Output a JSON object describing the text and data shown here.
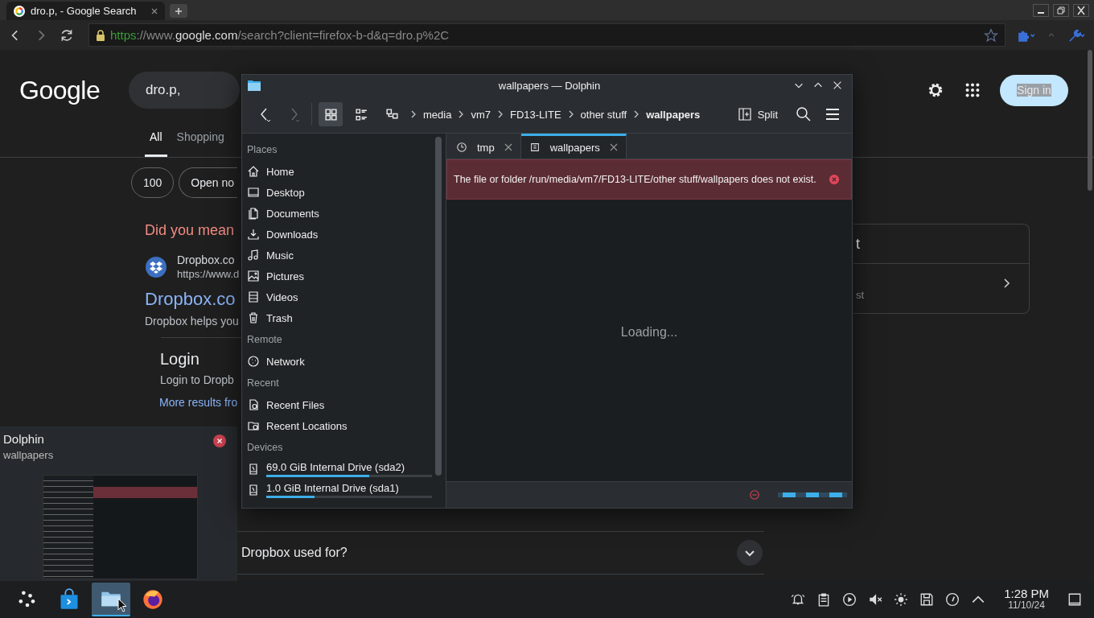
{
  "browser": {
    "tab": {
      "title": "dro.p, - Google Search"
    },
    "url": {
      "scheme": "https",
      "prefix": "://www.",
      "domain": "google.com",
      "path": "/search?client=firefox-b-d&q=dro.p%2C"
    }
  },
  "google": {
    "logo": "Google",
    "search_value": "dro.p,",
    "sign_in": "Sign in",
    "tabs": [
      {
        "label": "All",
        "selected": true
      },
      {
        "label": "Shopping",
        "selected": false
      }
    ],
    "chips": [
      "100",
      "Open no"
    ],
    "did_you_mean": "Did you mean",
    "result": {
      "site": "Dropbox.co",
      "url": "https://www.d",
      "title": "Dropbox.co",
      "snippet": "Dropbox helps you",
      "sitelink_title": "Login",
      "sitelink_snippet": "Login to Dropb",
      "more": "More results fro"
    },
    "questions": [
      "Dropbox used for?"
    ],
    "side_card": {
      "heading": "t",
      "sub": "st"
    }
  },
  "dolphin": {
    "title": "wallpapers — Dolphin",
    "forward_disabled": true,
    "view_modes": [
      {
        "kind": "icons",
        "selected": true
      },
      {
        "kind": "details",
        "selected": false
      },
      {
        "kind": "tree",
        "selected": false
      }
    ],
    "breadcrumb": [
      {
        "label": "media",
        "selected": false
      },
      {
        "label": "vm7",
        "selected": false
      },
      {
        "label": "FD13-LITE",
        "selected": false
      },
      {
        "label": "other stuff",
        "selected": false
      },
      {
        "label": "wallpapers",
        "selected": true
      }
    ],
    "split": "Split",
    "sidebar": [
      {
        "title": "Places",
        "items": [
          {
            "label": "Home",
            "kind": "home"
          },
          {
            "label": "Desktop",
            "kind": "desktop"
          },
          {
            "label": "Documents",
            "kind": "documents"
          },
          {
            "label": "Downloads",
            "kind": "downloads"
          },
          {
            "label": "Music",
            "kind": "music"
          },
          {
            "label": "Pictures",
            "kind": "pictures"
          },
          {
            "label": "Videos",
            "kind": "videos"
          },
          {
            "label": "Trash",
            "kind": "trash"
          }
        ]
      },
      {
        "title": "Remote",
        "items": [
          {
            "label": "Network",
            "kind": "network"
          }
        ]
      },
      {
        "title": "Recent",
        "items": [
          {
            "label": "Recent Files",
            "kind": "recentfiles"
          },
          {
            "label": "Recent Locations",
            "kind": "recentlocations"
          }
        ]
      },
      {
        "title": "Devices",
        "items": [
          {
            "label": "69.0 GiB Internal Drive (sda2)",
            "kind": "drive",
            "level": 0.62
          },
          {
            "label": "1.0 GiB Internal Drive (sda1)",
            "kind": "drive",
            "level": 0.29
          }
        ]
      }
    ],
    "tabs": [
      {
        "label": "tmp",
        "kind": "recent",
        "selected": false
      },
      {
        "label": "wallpapers",
        "kind": "folder",
        "selected": true
      }
    ],
    "error": "The file or folder /run/media/vm7/FD13-LITE/other stuff/wallpapers does not exist.",
    "loading": "Loading..."
  },
  "tooltip": {
    "title": "Dolphin",
    "subtitle": "wallpapers"
  },
  "taskbar": {
    "apps": [
      {
        "kind": "launcher",
        "selected": false
      },
      {
        "kind": "store",
        "selected": false
      },
      {
        "kind": "files",
        "selected": true
      },
      {
        "kind": "browser",
        "selected": false
      }
    ],
    "time": "1:28 PM",
    "date": "11/10/24"
  }
}
